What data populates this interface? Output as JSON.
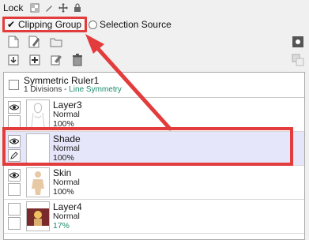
{
  "lock": {
    "label": "Lock"
  },
  "clipping": {
    "checkmark": "✔",
    "label": "Clipping Group",
    "checked": true
  },
  "selection_source": {
    "label": "Selection Source"
  },
  "ruler": {
    "name": "Symmetric Ruler1",
    "divisions": "1 Divisions - ",
    "type": "Line Symmetry"
  },
  "layers": [
    {
      "name": "Layer3",
      "mode": "Normal",
      "opacity": "100%"
    },
    {
      "name": "Shade",
      "mode": "Normal",
      "opacity": "100%"
    },
    {
      "name": "Skin",
      "mode": "Normal",
      "opacity": "100%"
    },
    {
      "name": "Layer4",
      "mode": "Normal",
      "opacity": "17%"
    }
  ],
  "colors": {
    "highlight": "#e23c3c",
    "selected_row": "#e6e6fa",
    "accent_green": "#1b8a6b"
  }
}
